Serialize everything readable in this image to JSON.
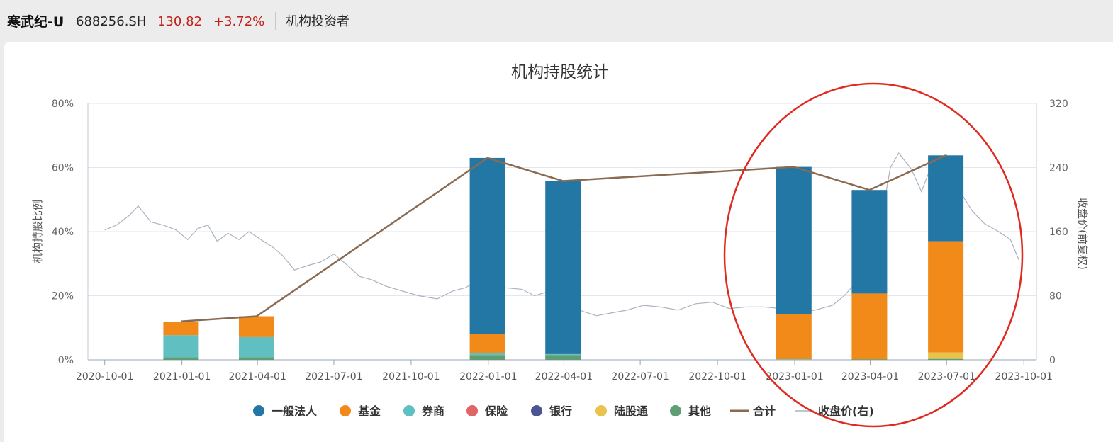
{
  "header": {
    "stock_name": "寒武纪-U",
    "stock_code": "688256.SH",
    "price": "130.82",
    "change": "+3.72%",
    "tab_label": "机构投资者"
  },
  "chart_data": {
    "type": "bar",
    "title": "机构持股统计",
    "ylabel": "机构持股比例",
    "y2label": "收盘价(前复权)",
    "ylim": [
      0,
      80
    ],
    "y2lim": [
      0,
      320
    ],
    "y_ticks": [
      "0%",
      "20%",
      "40%",
      "60%",
      "80%"
    ],
    "y2_ticks": [
      "0",
      "80",
      "160",
      "240",
      "320"
    ],
    "x_ticks": [
      "2020-10-01",
      "2021-01-01",
      "2021-04-01",
      "2021-07-01",
      "2021-10-01",
      "2022-01-01",
      "2022-04-01",
      "2022-07-01",
      "2022-10-01",
      "2023-01-01",
      "2023-04-01",
      "2023-07-01",
      "2023-10-01"
    ],
    "xlim": [
      "2020-09-11",
      "2023-10-16"
    ],
    "categories": [
      "2020-12-31",
      "2021-03-31",
      "2021-12-31",
      "2022-03-31",
      "2022-12-31",
      "2023-03-31",
      "2023-06-30"
    ],
    "series": [
      {
        "name": "其他",
        "color": "#5f9e75",
        "values": [
          0.8,
          0.8,
          1.5,
          1.5,
          0,
          0.2,
          0.3
        ]
      },
      {
        "name": "陆股通",
        "color": "#e8c54a",
        "values": [
          0,
          0,
          0,
          0,
          0,
          0,
          2.0
        ]
      },
      {
        "name": "银行",
        "color": "#4c5591",
        "values": [
          0,
          0,
          0,
          0,
          0,
          0,
          0
        ]
      },
      {
        "name": "保险",
        "color": "#e06566",
        "values": [
          0,
          0,
          0,
          0,
          0,
          0,
          0
        ]
      },
      {
        "name": "券商",
        "color": "#5fbfc1",
        "values": [
          6.9,
          6.3,
          0.5,
          0.3,
          0.2,
          0,
          0
        ]
      },
      {
        "name": "基金",
        "color": "#f28a1a",
        "values": [
          4.2,
          6.5,
          6.0,
          0,
          14.0,
          20.5,
          34.7
        ]
      },
      {
        "name": "一般法人",
        "color": "#2377a4",
        "values": [
          0,
          0,
          55.0,
          54.0,
          46.0,
          32.3,
          26.8
        ]
      }
    ],
    "total_series": {
      "name": "合计",
      "color": "#8b6a52",
      "values": [
        12.0,
        13.6,
        63.0,
        55.8,
        60.2,
        53.0,
        63.8
      ]
    },
    "price_series": {
      "name": "收盘价(右)",
      "color": "#aab2bf",
      "points": [
        [
          "2020-10-01",
          162
        ],
        [
          "2020-10-15",
          168
        ],
        [
          "2020-10-30",
          180
        ],
        [
          "2020-11-10",
          192
        ],
        [
          "2020-11-25",
          172
        ],
        [
          "2020-12-10",
          168
        ],
        [
          "2020-12-25",
          162
        ],
        [
          "2021-01-08",
          150
        ],
        [
          "2021-01-20",
          164
        ],
        [
          "2021-02-01",
          168
        ],
        [
          "2021-02-12",
          148
        ],
        [
          "2021-02-25",
          158
        ],
        [
          "2021-03-10",
          150
        ],
        [
          "2021-03-22",
          160
        ],
        [
          "2021-04-05",
          150
        ],
        [
          "2021-04-20",
          140
        ],
        [
          "2021-05-01",
          130
        ],
        [
          "2021-05-15",
          112
        ],
        [
          "2021-06-01",
          118
        ],
        [
          "2021-06-15",
          122
        ],
        [
          "2021-07-01",
          132
        ],
        [
          "2021-07-15",
          120
        ],
        [
          "2021-08-01",
          104
        ],
        [
          "2021-08-15",
          100
        ],
        [
          "2021-09-01",
          92
        ],
        [
          "2021-09-20",
          86
        ],
        [
          "2021-10-10",
          80
        ],
        [
          "2021-11-01",
          76
        ],
        [
          "2021-11-20",
          86
        ],
        [
          "2021-12-05",
          90
        ],
        [
          "2021-12-20",
          100
        ],
        [
          "2022-01-05",
          95
        ],
        [
          "2022-01-20",
          90
        ],
        [
          "2022-02-10",
          88
        ],
        [
          "2022-02-25",
          80
        ],
        [
          "2022-03-10",
          84
        ],
        [
          "2022-03-25",
          74
        ],
        [
          "2022-04-10",
          66
        ],
        [
          "2022-04-25",
          60
        ],
        [
          "2022-05-10",
          55
        ],
        [
          "2022-05-25",
          58
        ],
        [
          "2022-06-15",
          62
        ],
        [
          "2022-07-05",
          68
        ],
        [
          "2022-07-25",
          66
        ],
        [
          "2022-08-15",
          62
        ],
        [
          "2022-09-05",
          70
        ],
        [
          "2022-09-25",
          72
        ],
        [
          "2022-10-15",
          64
        ],
        [
          "2022-11-05",
          66
        ],
        [
          "2022-11-25",
          66
        ],
        [
          "2022-12-15",
          64
        ],
        [
          "2023-01-05",
          60
        ],
        [
          "2023-01-25",
          62
        ],
        [
          "2023-02-15",
          68
        ],
        [
          "2023-03-01",
          80
        ],
        [
          "2023-03-15",
          96
        ],
        [
          "2023-04-01",
          110
        ],
        [
          "2023-04-15",
          180
        ],
        [
          "2023-04-25",
          240
        ],
        [
          "2023-05-05",
          258
        ],
        [
          "2023-05-20",
          238
        ],
        [
          "2023-06-01",
          210
        ],
        [
          "2023-06-15",
          248
        ],
        [
          "2023-06-25",
          235
        ],
        [
          "2023-07-01",
          255
        ],
        [
          "2023-07-10",
          215
        ],
        [
          "2023-07-20",
          205
        ],
        [
          "2023-08-01",
          185
        ],
        [
          "2023-08-15",
          170
        ],
        [
          "2023-09-01",
          160
        ],
        [
          "2023-09-15",
          150
        ],
        [
          "2023-09-25",
          125
        ]
      ]
    },
    "legend_position": "bottom",
    "grid": true
  }
}
